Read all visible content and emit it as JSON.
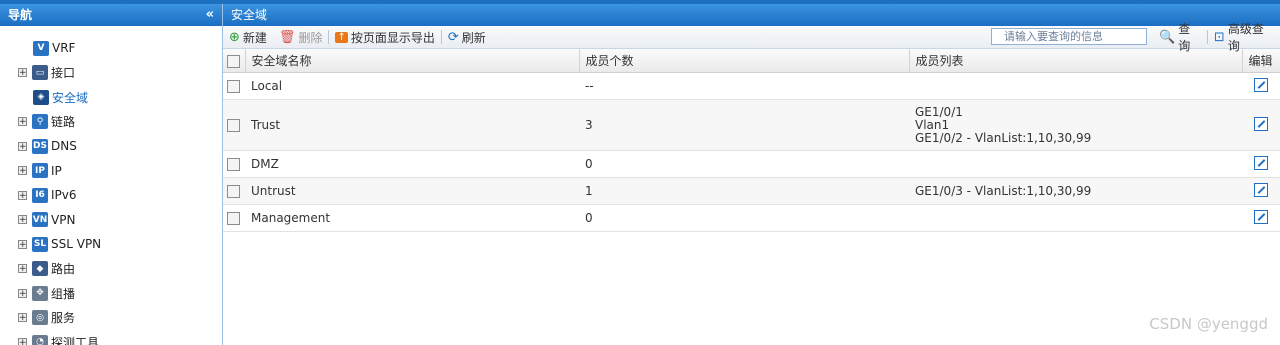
{
  "sidebar": {
    "title": "导航",
    "collapse_icon": "«",
    "items": [
      {
        "label": "VRF",
        "icon": "vrf-icon",
        "level": "child",
        "expander": ""
      },
      {
        "label": "接口",
        "icon": "interface-icon",
        "level": "top",
        "expander": "+"
      },
      {
        "label": "安全域",
        "icon": "security-zone-icon",
        "level": "child",
        "expander": "",
        "active": true
      },
      {
        "label": "链路",
        "icon": "link-icon",
        "level": "top",
        "expander": "+"
      },
      {
        "label": "DNS",
        "icon": "dns-icon",
        "level": "top",
        "expander": "+"
      },
      {
        "label": "IP",
        "icon": "ip-icon",
        "level": "top",
        "expander": "+"
      },
      {
        "label": "IPv6",
        "icon": "ipv6-icon",
        "level": "top",
        "expander": "+"
      },
      {
        "label": "VPN",
        "icon": "vpn-icon",
        "level": "top",
        "expander": "+"
      },
      {
        "label": "SSL VPN",
        "icon": "sslvpn-icon",
        "level": "top",
        "expander": "+"
      },
      {
        "label": "路由",
        "icon": "route-icon",
        "level": "top",
        "expander": "+"
      },
      {
        "label": "组播",
        "icon": "multicast-icon",
        "level": "top",
        "expander": "+"
      },
      {
        "label": "服务",
        "icon": "service-icon",
        "level": "top",
        "expander": "+"
      },
      {
        "label": "探测工具",
        "icon": "probe-icon",
        "level": "top",
        "expander": "+"
      }
    ]
  },
  "main": {
    "title": "安全域",
    "toolbar": {
      "new_label": "新建",
      "delete_label": "删除",
      "export_label": "按页面显示导出",
      "refresh_label": "刷新",
      "search_placeholder": "请输入要查询的信息",
      "query_label": "查询",
      "advanced_label": "高级查询"
    },
    "table": {
      "headers": [
        "安全域名称",
        "成员个数",
        "成员列表",
        "编辑"
      ],
      "rows": [
        {
          "name": "Local",
          "count": "--",
          "members": []
        },
        {
          "name": "Trust",
          "count": "3",
          "members": [
            "GE1/0/1",
            "Vlan1",
            "GE1/0/2 - VlanList:1,10,30,99"
          ]
        },
        {
          "name": "DMZ",
          "count": "0",
          "members": []
        },
        {
          "name": "Untrust",
          "count": "1",
          "members": [
            "GE1/0/3 - VlanList:1,10,30,99"
          ]
        },
        {
          "name": "Management",
          "count": "0",
          "members": []
        }
      ]
    }
  },
  "watermark": "CSDN @yenggd",
  "colors": {
    "header_blue": "#1b6ec2",
    "active_link": "#1b6ec2"
  }
}
